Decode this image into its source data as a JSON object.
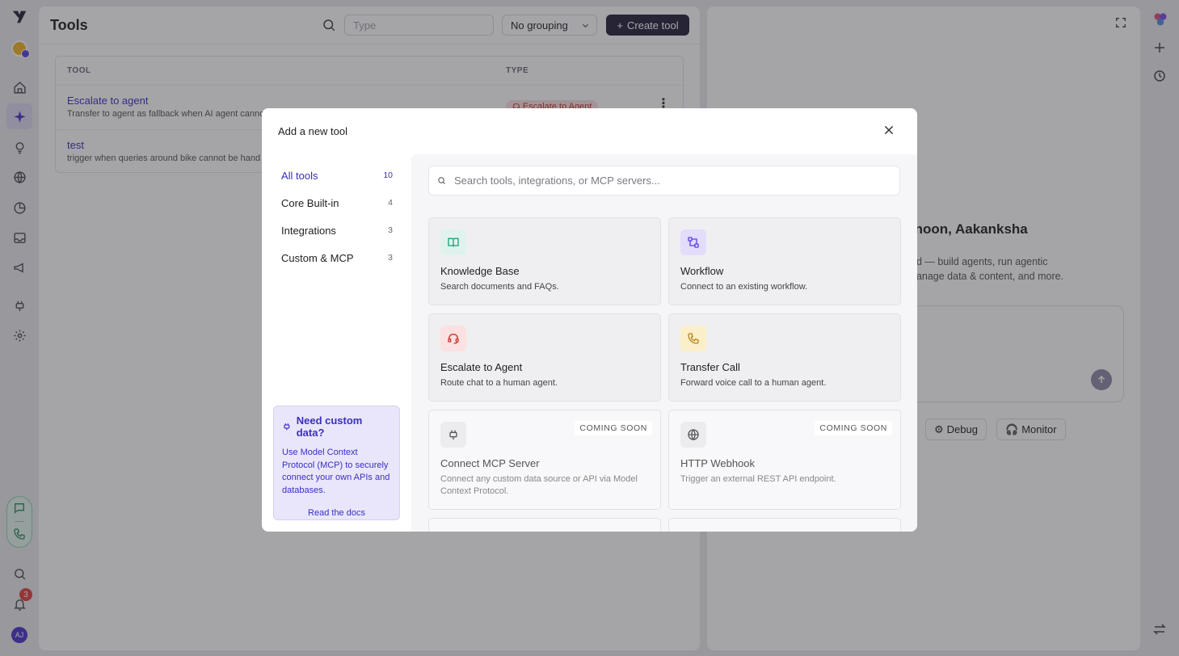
{
  "app": {
    "page_title": "Tools",
    "user_initials": "AJ",
    "notification_count": "3"
  },
  "toolbar": {
    "search_placeholder": "Type",
    "grouping_label": "No grouping",
    "create_label": "Create tool"
  },
  "table": {
    "headers": [
      "TOOL",
      "TYPE"
    ],
    "rows": [
      {
        "name": "Escalate to agent",
        "description": "Transfer to agent as fallback when AI agent canno",
        "type": "Escalate to Agent"
      },
      {
        "name": "test",
        "description": "trigger when queries around bike cannot be hand",
        "type": ""
      }
    ]
  },
  "assistant": {
    "greeting": "rnoon, Aakanksha",
    "sub_line1": "ed — build agents, run agentic",
    "sub_line2": "nanage data & content, and more.",
    "chips": [
      "Debug",
      "Monitor"
    ]
  },
  "modal": {
    "title": "Add a new tool",
    "search_placeholder": "Search tools, integrations, or MCP servers...",
    "categories": [
      {
        "label": "All tools",
        "count": "10"
      },
      {
        "label": "Core Built-in",
        "count": "4"
      },
      {
        "label": "Integrations",
        "count": "3"
      },
      {
        "label": "Custom & MCP",
        "count": "3"
      }
    ],
    "mcp_card": {
      "heading": "Need custom data?",
      "body": "Use Model Context Protocol (MCP) to securely connect your own APIs and databases.",
      "link": "Read the docs"
    },
    "tools": [
      {
        "name": "Knowledge Base",
        "description": "Search documents and FAQs.",
        "icon": "book-icon",
        "color": "#1f9d7a",
        "bg": "#dff3ec"
      },
      {
        "name": "Workflow",
        "description": "Connect to an existing workflow.",
        "icon": "workflow-icon",
        "color": "#5b3ee0",
        "bg": "#e3dcfb"
      },
      {
        "name": "Escalate to Agent",
        "description": "Route chat to a human agent.",
        "icon": "headset-icon",
        "color": "#c2352f",
        "bg": "#fbe1e1"
      },
      {
        "name": "Transfer Call",
        "description": "Forward voice call to a human agent.",
        "icon": "phone-icon",
        "color": "#b9801a",
        "bg": "#fbefc9"
      },
      {
        "name": "Connect MCP Server",
        "description": "Connect any custom data source or API via Model Context Protocol.",
        "icon": "plug-icon",
        "badge": "COMING SOON"
      },
      {
        "name": "HTTP Webhook",
        "description": "Trigger an external REST API endpoint.",
        "icon": "globe-icon",
        "badge": "COMING SOON"
      }
    ]
  }
}
